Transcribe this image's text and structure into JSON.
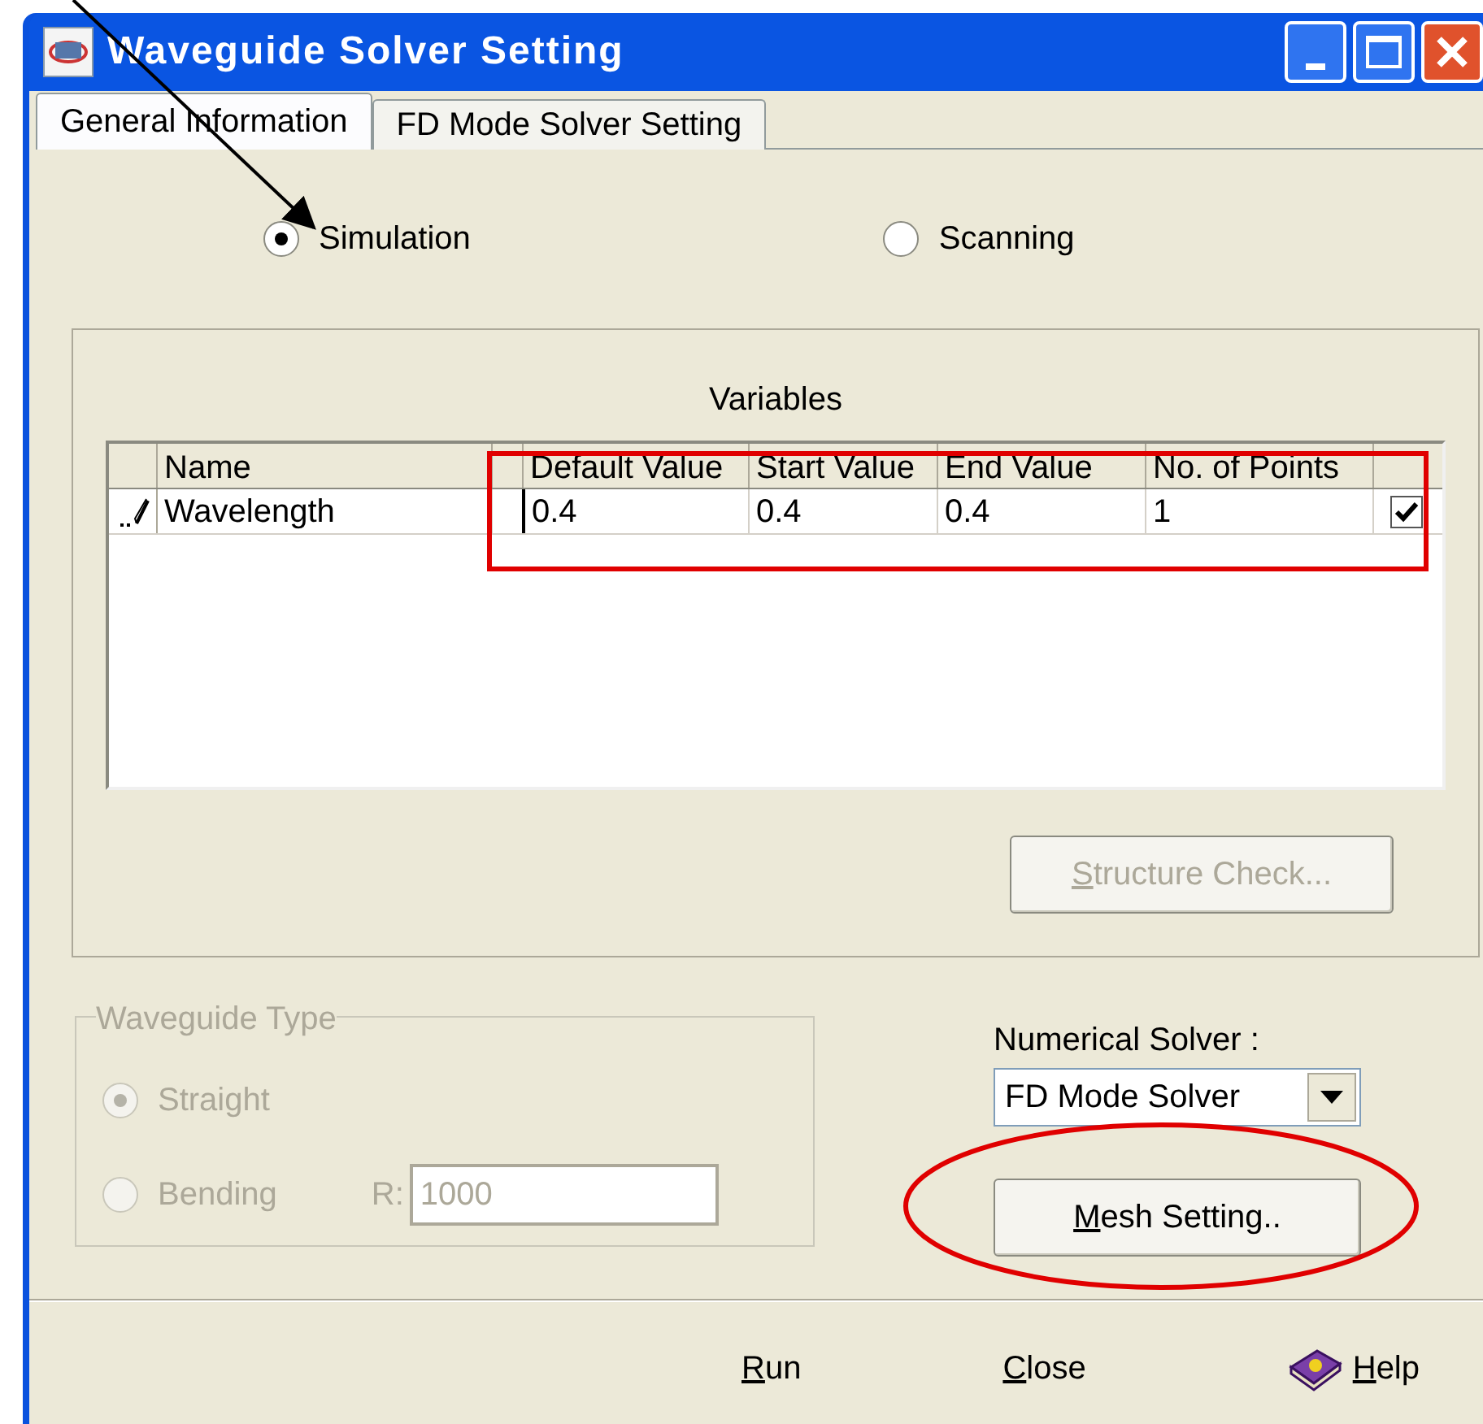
{
  "window": {
    "title": "Waveguide Solver Setting"
  },
  "tabs": [
    {
      "label": "General Information",
      "selected": true
    },
    {
      "label": "FD Mode Solver Setting",
      "selected": false
    }
  ],
  "mode": [
    {
      "label": "Simulation",
      "selected": true
    },
    {
      "label": "Scanning",
      "selected": false
    }
  ],
  "variables": {
    "title": "Variables",
    "columns": [
      "Name",
      "Default Value",
      "Start Value",
      "End Value",
      "No. of Points"
    ],
    "rows": [
      {
        "name": "Wavelength",
        "default_value": "0.4",
        "start_value": "0.4",
        "end_value": "0.4",
        "points": "1",
        "checked": true
      }
    ]
  },
  "structure_check": {
    "label": "Structure Check...",
    "disabled": true,
    "mnemonic": true
  },
  "waveguide_type": {
    "title": "Waveguide Type",
    "disabled": true,
    "options": [
      {
        "label": "Straight",
        "selected": true
      },
      {
        "label": "Bending",
        "selected": false
      }
    ],
    "radius": {
      "label": "R:",
      "value": "1000"
    }
  },
  "numerical_solver": {
    "label": "Numerical Solver :",
    "value": "FD Mode Solver"
  },
  "mesh_button": {
    "label": "Mesh Setting..",
    "disabled": false,
    "mnemonic": true
  },
  "footer": [
    {
      "label": "Run",
      "kind": "plain",
      "mnemonic": true
    },
    {
      "label": "Close",
      "kind": "plain",
      "mnemonic": true
    },
    {
      "label": "Help",
      "kind": "help",
      "mnemonic": true
    }
  ]
}
